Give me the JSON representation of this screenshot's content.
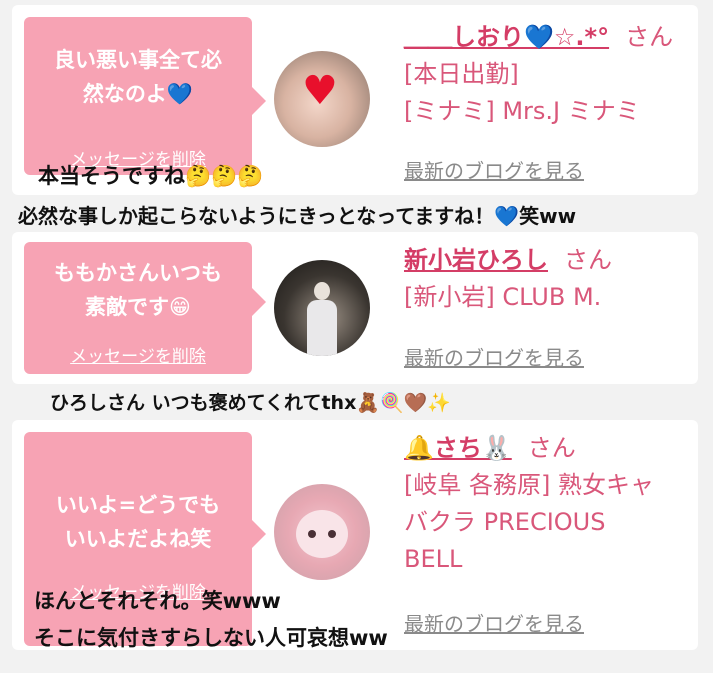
{
  "items": [
    {
      "message_line1": "良い悪い事全て必",
      "message_line2": "然なのよ💙",
      "delete_label": "メッセージを削除",
      "name": "＿＿しおり💙☆.*°",
      "honorific": "さん[本日出勤]",
      "shop": "[ミナミ] Mrs.J ミナミ",
      "shop_line2": "",
      "shop_line3": "",
      "blog_label": "最新のブログを見る"
    },
    {
      "message_line1": "ももかさんいつも",
      "message_line2": "素敵です😁",
      "delete_label": "メッセージを削除",
      "name": "新小岩ひろし",
      "honorific": "さん",
      "shop": "[新小岩] CLUB M.",
      "blog_label": "最新のブログを見る"
    },
    {
      "message_line1": "いいよ=どうでも",
      "message_line2": "いいよだよね笑",
      "delete_label": "メッセージを削除",
      "name": "🔔さち🐰",
      "honorific": "さん",
      "shop": "[岐阜 各務原]  熟女キャ",
      "shop_line2": "バクラ PRECIOUS",
      "shop_line3": "BELL",
      "blog_label": "最新のブログを見る"
    }
  ],
  "captions": {
    "c1": "本当そうですね🤔🤔🤔",
    "c2": "必然な事しか起こらないようにきっとなってますね！💙笑ww",
    "c3": "ひろしさん いつも褒めてくれてthx🧸🍭🤎✨",
    "c4": "ほんとそれそれ。笑www",
    "c5": "そこに気付きすらしない人可哀想ww"
  },
  "colors": {
    "bubble": "#f7a3b4",
    "name": "#d43d66",
    "shop_text": "#d9577a",
    "link_gray": "#8a8a8a"
  },
  "icons": [
    "heart-avatar-icon",
    "person-avatar-icon",
    "cat-avatar-icon"
  ]
}
